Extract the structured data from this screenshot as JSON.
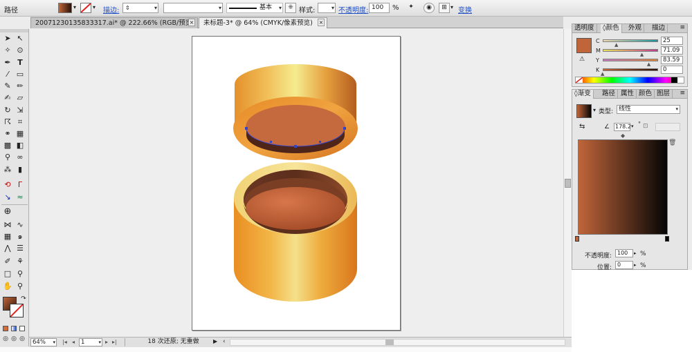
{
  "control_bar": {
    "object_type": "路径",
    "stroke_label": "描边:",
    "stroke_style": "基本",
    "style_label": "样式:",
    "opacity_label": "不透明度:",
    "opacity_value": "100",
    "opacity_unit": "%",
    "transform_label": "变换"
  },
  "document_tabs": [
    {
      "label": "20071230135833317.ai* @ 222.66% (RGB/预览)",
      "active": false
    },
    {
      "label": "未标题-3* @ 64% (CMYK/像素预览)",
      "active": true
    }
  ],
  "tab_close_glyph": "×",
  "status_bar": {
    "zoom": "64%",
    "page": "1",
    "message": "18 次还原; 无重做"
  },
  "color_panel": {
    "tabs": [
      "透明度",
      "颜色",
      "外观",
      "描边"
    ],
    "active_tab": "颜色",
    "channels": [
      {
        "label": "C",
        "value": "25",
        "fraction": 0.25
      },
      {
        "label": "M",
        "value": "71.09",
        "fraction": 0.7109
      },
      {
        "label": "Y",
        "value": "83.59",
        "fraction": 0.8359
      },
      {
        "label": "K",
        "value": "0",
        "fraction": 0
      }
    ],
    "swatch_color": "#c0653a"
  },
  "gradient_panel": {
    "tabs": [
      "渐变",
      "路径",
      "属性",
      "颜色",
      "图层"
    ],
    "active_tab": "渐变",
    "type_label": "类型:",
    "type_value": "线性",
    "angle_value": "178.2",
    "angle_unit": "°",
    "opacity_label": "不透明度:",
    "opacity_value": "100",
    "opacity_unit": "%",
    "location_label": "位置:",
    "location_value": "0",
    "location_unit": "%",
    "stop_colors": [
      "#c0653a",
      "#050505"
    ]
  },
  "colors": {
    "lid_gold_light": "#f4e88a",
    "body_orange": "#f2a23a",
    "inner_brown": "#c2643a",
    "selection_blue": "#3344cc"
  }
}
